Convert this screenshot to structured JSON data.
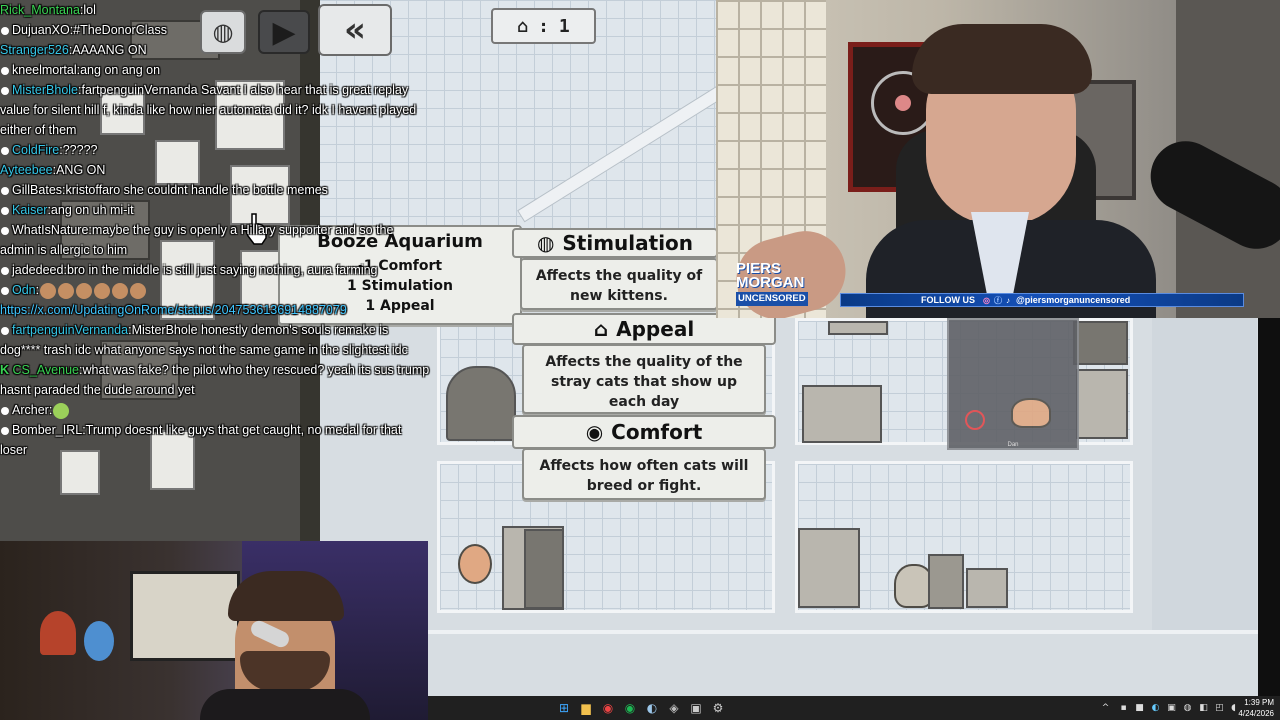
{
  "chat": {
    "messages": [
      {
        "user": "Rick_Montana",
        "color": "#39d353",
        "badge": "",
        "text": "lol"
      },
      {
        "user": "DujuanXO",
        "color": "#ffffff",
        "badge": "dot",
        "text": "#TheDonorClass"
      },
      {
        "user": "Stranger526",
        "color": "#35c7e8",
        "badge": "",
        "text": "AAAANG ON"
      },
      {
        "user": "kneelmortal",
        "color": "#ffffff",
        "badge": "dot",
        "text": "ang on ang on"
      },
      {
        "user": "MisterBhole",
        "color": "#35c7e8",
        "badge": "dot",
        "text": "fartpenguinVernanda Savant I also hear that is great replay value for silent hill f, kinda like how nier automata did it? idk I havent played either of them"
      },
      {
        "user": "ColdFire",
        "color": "#35c7e8",
        "badge": "dot",
        "text": "?????"
      },
      {
        "user": "Ayteebee",
        "color": "#35c7e8",
        "badge": "",
        "text": "ANG ON"
      },
      {
        "user": "GillBates",
        "color": "#ffffff",
        "badge": "dot",
        "text": "kristoffaro she couldnt handle the bottle memes"
      },
      {
        "user": "Kaiser",
        "color": "#35c7e8",
        "badge": "dot",
        "text": "ang on uh mi-it"
      },
      {
        "user": "WhatIsNature",
        "color": "#ffffff",
        "badge": "dot",
        "text": "maybe the guy is openly a Hillary supporter and so the admin is allergic to him"
      },
      {
        "user": "jadedeed",
        "color": "#ffffff",
        "badge": "dot",
        "text": "bro in the middle is still just saying nothing, aura farming"
      },
      {
        "user": "Odn",
        "color": "#35c7e8",
        "badge": "dot",
        "text": ""
      },
      {
        "user": "",
        "color": "#35c7e8",
        "badge": "",
        "text": "https://x.com/UpdatingOnRome/status/2047536136914887079",
        "link": true
      },
      {
        "user": "fartpenguinVernanda",
        "color": "#35c7e8",
        "badge": "dot",
        "text": "MisterBhole honestly demon's souls remake is dog**** trash idc what anyone says not the same game in the slightest idc"
      },
      {
        "user": "CS_Avenue",
        "color": "#39d353",
        "badge": "K",
        "text": "what was fake? the pilot who they rescued? yeah its sus trump hasnt paraded the dude around yet"
      },
      {
        "user": "Archer",
        "color": "#ffffff",
        "badge": "dot",
        "text": ""
      },
      {
        "user": "Bomber_IRL",
        "color": "#ffffff",
        "badge": "dot",
        "text": "Trump doesnt like guys that get caught, no medal for that loser"
      }
    ]
  },
  "game": {
    "house_counter": "1",
    "tooltip_item": {
      "title": "Booze Aquarium",
      "stats": [
        "-1 Comfort",
        "1 Stimulation",
        "1 Appeal"
      ]
    },
    "stimulation": {
      "title": "Stimulation",
      "body": "Affects the quality of new kittens."
    },
    "appeal": {
      "title": "Appeal",
      "body": "Affects the quality of the stray cats that show up each day"
    },
    "comfort": {
      "title": "Comfort",
      "body": "Affects how often cats will breed or fight."
    },
    "cat_label": "Dan"
  },
  "overlay": {
    "brand_line1": "PIERS",
    "brand_line2": "MORGAN",
    "brand_line3": "UNCENSORED",
    "follow_label": "FOLLOW US",
    "handle": "@piersmorganuncensored"
  },
  "taskbar": {
    "time": "1:39 PM",
    "date": "4/24/2026"
  },
  "colors": {
    "chat_link": "#3fc6ff",
    "piers_blue": "#1a4fa8",
    "taskbar_bg": "#202020"
  }
}
